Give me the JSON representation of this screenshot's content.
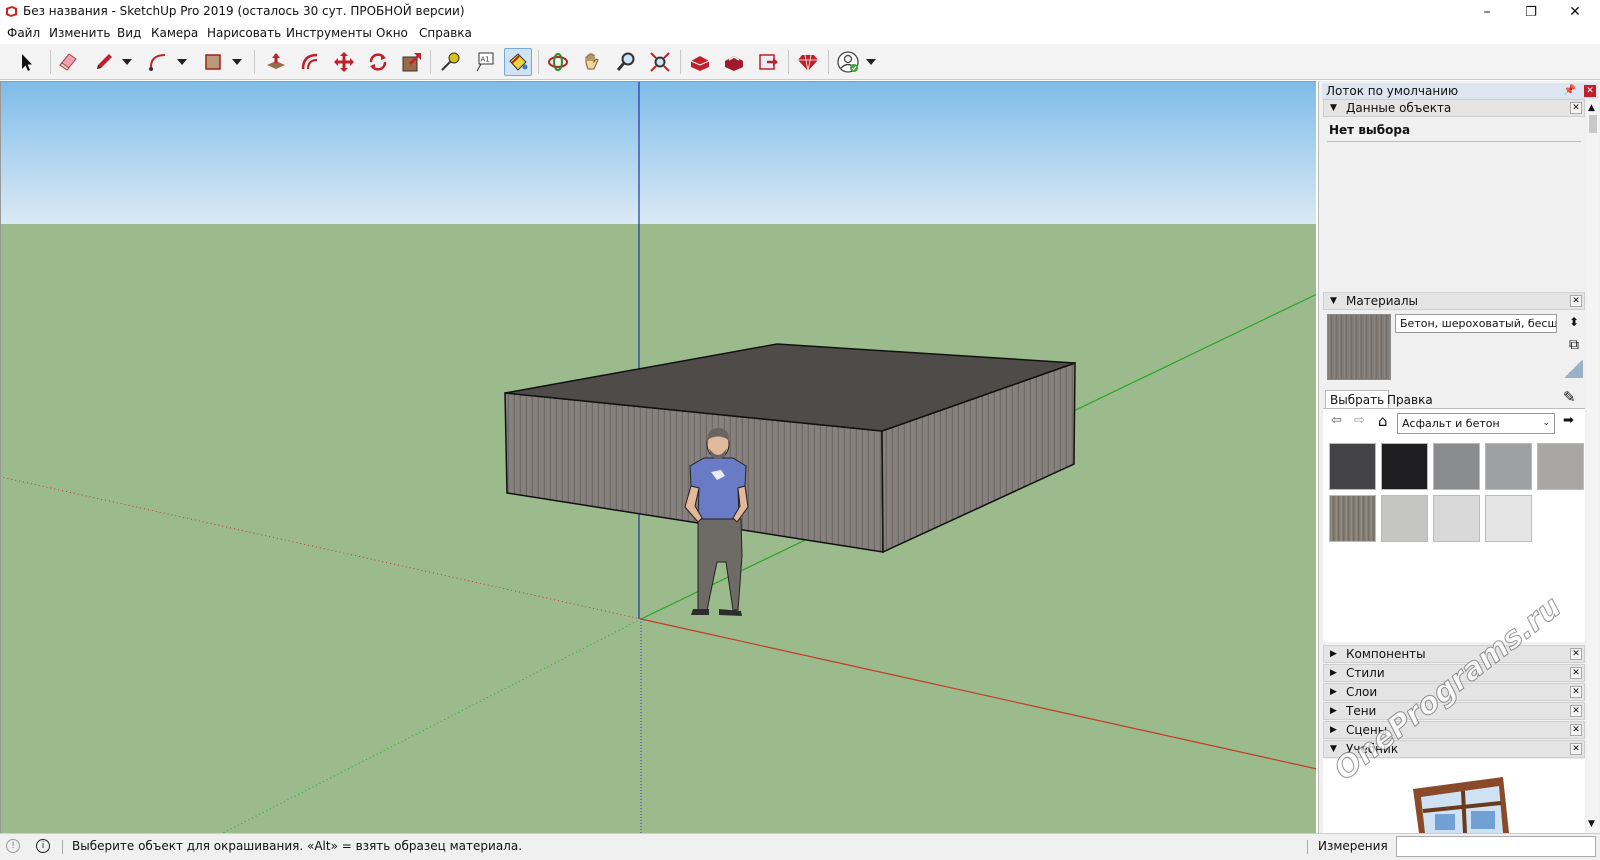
{
  "window": {
    "title": "Без названия - SketchUp Pro 2019 (осталось 30 сут. ПРОБНОЙ версии)",
    "minimize": "–",
    "restore": "❐",
    "close": "✕"
  },
  "menu": [
    "Файл",
    "Изменить",
    "Вид",
    "Камера",
    "Нарисовать",
    "Инструменты",
    "Окно",
    "Справка"
  ],
  "toolbar": {
    "tools": [
      {
        "name": "select-tool",
        "icon": "arrow-cursor-icon"
      },
      {
        "name": "eraser-tool",
        "icon": "eraser-icon"
      },
      {
        "name": "line-tool",
        "icon": "pencil-icon"
      },
      {
        "name": "arc-tool",
        "icon": "arc-icon"
      },
      {
        "name": "rectangle-tool",
        "icon": "rectangle-icon"
      },
      {
        "name": "push-pull-tool",
        "icon": "push-pull-icon"
      },
      {
        "name": "offset-tool",
        "icon": "offset-icon"
      },
      {
        "name": "move-tool",
        "icon": "move-icon"
      },
      {
        "name": "rotate-tool",
        "icon": "rotate-icon"
      },
      {
        "name": "scale-tool",
        "icon": "scale-icon"
      },
      {
        "name": "tape-measure-tool",
        "icon": "tape-measure-icon"
      },
      {
        "name": "text-tool",
        "icon": "text-icon"
      },
      {
        "name": "paint-bucket-tool",
        "icon": "paint-bucket-icon"
      },
      {
        "name": "orbit-tool",
        "icon": "orbit-icon"
      },
      {
        "name": "pan-tool",
        "icon": "hand-icon"
      },
      {
        "name": "zoom-tool",
        "icon": "magnifier-icon"
      },
      {
        "name": "zoom-extents-tool",
        "icon": "zoom-extents-icon"
      },
      {
        "name": "3d-warehouse-button",
        "icon": "warehouse-icon"
      },
      {
        "name": "extension-warehouse-button",
        "icon": "extension-warehouse-icon"
      },
      {
        "name": "send-to-layout-button",
        "icon": "layout-icon"
      },
      {
        "name": "extension-manager-button",
        "icon": "ruby-gem-icon"
      },
      {
        "name": "account-button",
        "icon": "user-icon"
      }
    ],
    "text_tool_label": "A1"
  },
  "tray": {
    "title": "Лоток по умолчанию",
    "entity_info": {
      "header": "Данные объекта",
      "selection": "Нет выбора"
    },
    "materials": {
      "header": "Материалы",
      "material_name": "Бетон, шероховатый, бесшовный",
      "tab_select": "Выбрать",
      "tab_edit": "Правка",
      "collection": "Асфальт и бетон",
      "swatches": [
        "#444446",
        "#1e1e20",
        "#8a8c8d",
        "#9ea0a1",
        "#a9a7a4",
        "#857f76",
        "#c5c6c4",
        "#d7d8d7",
        "#e4e5e4"
      ]
    },
    "collapsed_panels": [
      "Компоненты",
      "Стили",
      "Слои",
      "Тени",
      "Сцены"
    ],
    "instructor": {
      "header": "Учебник"
    }
  },
  "statusbar": {
    "message": "Выберите объект для окрашивания. «Alt» = взять образец материала.",
    "measurements_label": "Измерения",
    "measurements_value": ""
  },
  "watermark": "OnePrograms.ru",
  "colors": {
    "sky_top": "#7fbce8",
    "sky_bottom": "#dbeaf5",
    "ground": "#9bbb8c",
    "axis_red": "#c43a2a",
    "axis_green": "#2aa52a",
    "axis_blue": "#2233aa",
    "box_top": "#4e4b49",
    "box_wood": "#7d7875"
  }
}
